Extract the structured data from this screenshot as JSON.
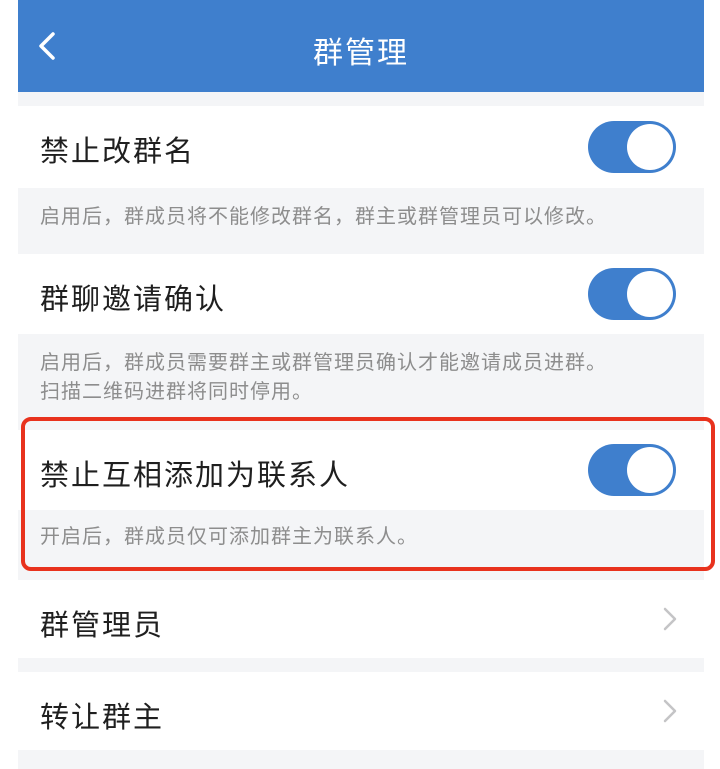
{
  "navbar": {
    "title": "群管理",
    "back_icon": "chevron-left-icon",
    "background": "#3f7fcd"
  },
  "settings": [
    {
      "label": "禁止改群名",
      "enabled": true,
      "description": "启用后，群成员将不能修改群名，群主或群管理员可以修改。"
    },
    {
      "label": "群聊邀请确认",
      "enabled": true,
      "description_line1": "启用后，群成员需要群主或群管理员确认才能邀请成员进群。",
      "description_line2": "扫描二维码进群将同时停用。"
    },
    {
      "label": "禁止互相添加为联系人",
      "enabled": true,
      "description": "开启后，群成员仅可添加群主为联系人。",
      "highlighted": true
    }
  ],
  "links": [
    {
      "label": "群管理员",
      "icon": "chevron-right-icon"
    },
    {
      "label": "转让群主",
      "icon": "chevron-right-icon"
    }
  ],
  "colors": {
    "accent": "#3f7fcd",
    "highlight_border": "#e8321d",
    "description_text": "#8d8d8d"
  }
}
